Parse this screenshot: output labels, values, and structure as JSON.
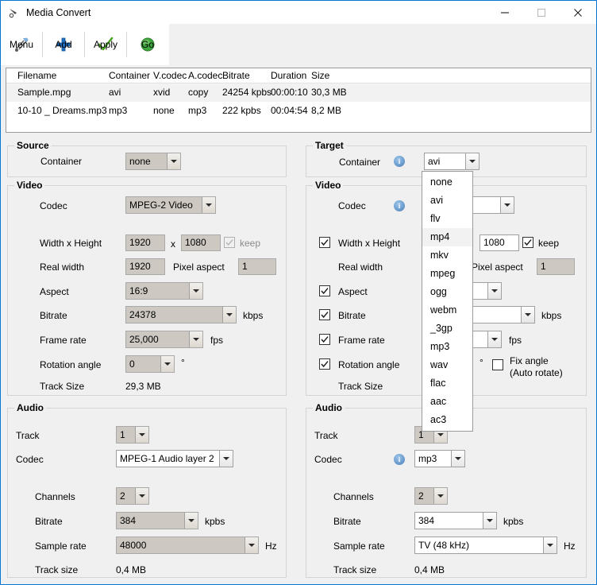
{
  "window": {
    "title": "Media Convert",
    "icon": "media-convert-icon",
    "minimize_label": "—",
    "maximize_label": "□",
    "close_label": "✕"
  },
  "toolbar": {
    "items": [
      {
        "label": "Menu",
        "icon": "tools-icon"
      },
      {
        "label": "Add",
        "icon": "plus-icon"
      },
      {
        "label": "Apply",
        "icon": "check-icon"
      },
      {
        "label": "Go",
        "icon": "green-circle-icon"
      }
    ]
  },
  "filelist": {
    "columns": [
      "Filename",
      "Container",
      "V.codec",
      "A.codec",
      "Bitrate",
      "Duration",
      "Size"
    ],
    "rows": [
      {
        "filename": "Sample.mpg",
        "container": "avi",
        "vcodec": "xvid",
        "acodec": "copy",
        "bitrate": "24254 kpbs",
        "duration": "00:00:10",
        "size": "30,3 MB",
        "selected": true
      },
      {
        "filename": "10-10 _ Dreams.mp3",
        "container": "mp3",
        "vcodec": "none",
        "acodec": "mp3",
        "bitrate": "222 kpbs",
        "duration": "00:04:54",
        "size": "8,2 MB",
        "selected": false
      }
    ]
  },
  "source": {
    "title": "Source",
    "container_label": "Container",
    "container_value": "none",
    "video": {
      "title": "Video",
      "codec_label": "Codec",
      "codec_value": "MPEG-2 Video",
      "width_height_label": "Width x Height",
      "width_value": "1920",
      "x_label": "x",
      "height_value": "1080",
      "keep_label": "keep",
      "keep_checked": true,
      "real_width_label": "Real width",
      "real_width_value": "1920",
      "pixel_aspect_label": "Pixel aspect",
      "pixel_aspect_value": "1",
      "aspect_label": "Aspect",
      "aspect_value": "16:9",
      "bitrate_label": "Bitrate",
      "bitrate_value": "24378",
      "bitrate_unit": "kbps",
      "frame_rate_label": "Frame rate",
      "frame_rate_value": "25,000",
      "frame_rate_unit": "fps",
      "rotation_label": "Rotation angle",
      "rotation_value": "0",
      "rotation_unit": "°",
      "track_size_label": "Track Size",
      "track_size_value": "29,3 MB"
    },
    "audio": {
      "title": "Audio",
      "track_label": "Track",
      "track_value": "1",
      "codec_label": "Codec",
      "codec_value": "MPEG-1 Audio layer 2",
      "channels_label": "Channels",
      "channels_value": "2",
      "bitrate_label": "Bitrate",
      "bitrate_value": "384",
      "bitrate_unit": "kpbs",
      "sample_rate_label": "Sample rate",
      "sample_rate_value": "48000",
      "sample_rate_unit": "Hz",
      "track_size_label": "Track size",
      "track_size_value": "0,4 MB"
    }
  },
  "target": {
    "title": "Target",
    "container_label": "Container",
    "container_value": "avi",
    "container_info_icon": "info-icon",
    "container_dropdown_open": true,
    "container_options": [
      "none",
      "avi",
      "flv",
      "mp4",
      "mkv",
      "mpeg",
      "ogg",
      "webm",
      "_3gp",
      "mp3",
      "wav",
      "flac",
      "aac",
      "ac3"
    ],
    "container_highlighted_option": "mp4",
    "video": {
      "title": "Video",
      "codec_label": "Codec",
      "codec_info_icon": "info-icon",
      "width_height_label": "Width x Height",
      "width_height_checked": true,
      "height_value": "1080",
      "keep_label": "keep",
      "keep_checked": true,
      "real_width_label": "Real width",
      "pixel_aspect_label": "Pixel aspect",
      "pixel_aspect_value": "1",
      "aspect_label": "Aspect",
      "aspect_checked": true,
      "bitrate_label": "Bitrate",
      "bitrate_checked": true,
      "bitrate_unit": "kbps",
      "frame_rate_label": "Frame rate",
      "frame_rate_checked": true,
      "frame_rate_unit": "fps",
      "rotation_label": "Rotation angle",
      "rotation_checked": true,
      "rotation_unit": "°",
      "fix_angle_label_1": "Fix angle",
      "fix_angle_label_2": "(Auto rotate)",
      "fix_angle_checked": false,
      "track_size_label": "Track Size"
    },
    "audio": {
      "title": "Audio",
      "track_label": "Track",
      "track_value": "1",
      "codec_label": "Codec",
      "codec_info_icon": "info-icon",
      "codec_value": "mp3",
      "channels_label": "Channels",
      "channels_value": "2",
      "bitrate_label": "Bitrate",
      "bitrate_value": "384",
      "bitrate_unit": "kpbs",
      "sample_rate_label": "Sample rate",
      "sample_rate_value": "TV (48 kHz)",
      "sample_rate_unit": "Hz",
      "track_size_label": "Track size",
      "track_size_value": "0,4 MB"
    }
  },
  "colors": {
    "window_border": "#0078d7",
    "panel_bg": "#f0f0f0",
    "readonly_field": "#cdc9c2",
    "accent_blue": "#2b6cb0",
    "go_green": "#3fa63f"
  }
}
